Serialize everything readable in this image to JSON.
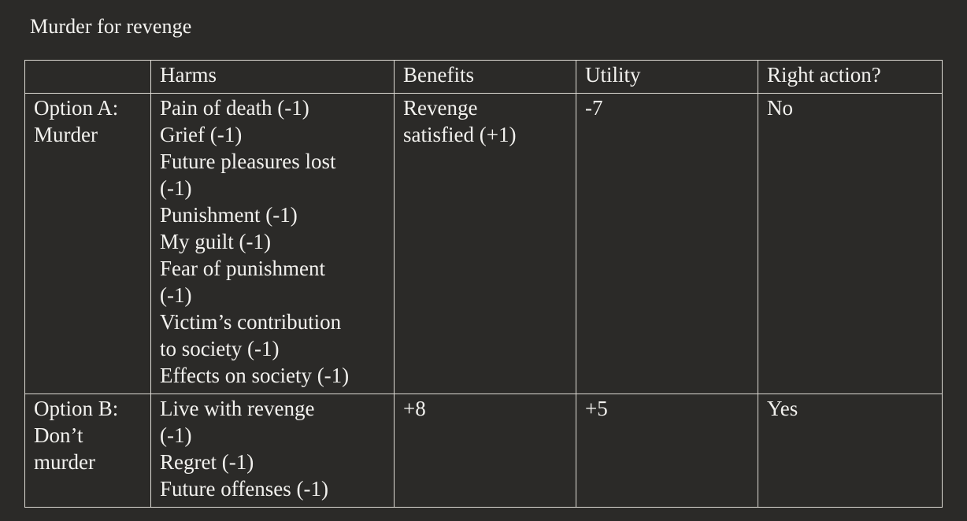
{
  "document": {
    "title": "Murder for revenge"
  },
  "table": {
    "headers": {
      "blank": "",
      "harms": "Harms",
      "benefits": "Benefits",
      "utility": "Utility",
      "right_action": "Right action?"
    },
    "rows": [
      {
        "option_lines": [
          "Option A:",
          "Murder"
        ],
        "harms_lines": [
          "Pain of death (-1)",
          "Grief (-1)",
          "Future pleasures lost",
          "(-1)",
          "Punishment (-1)",
          "My guilt (-1)",
          "Fear of punishment",
          "(-1)",
          "Victim’s contribution",
          "to society (-1)",
          "Effects on society (-1)"
        ],
        "benefits_lines": [
          "Revenge",
          "satisfied (+1)"
        ],
        "utility": "-7",
        "right_action": "No"
      },
      {
        "option_lines": [
          "Option B:",
          "Don’t",
          "murder"
        ],
        "harms_lines": [
          "Live with revenge",
          "(-1)",
          "Regret (-1)",
          "Future offenses (-1)"
        ],
        "benefits_lines": [
          "+8"
        ],
        "utility": "+5",
        "right_action": "Yes"
      }
    ]
  },
  "colors": {
    "background": "#2b2a28",
    "text": "#f2f1ee",
    "border": "#dedbd5"
  }
}
